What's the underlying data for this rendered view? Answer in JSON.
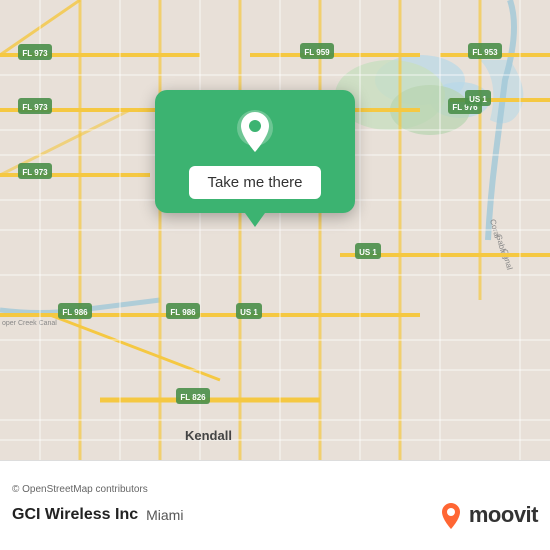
{
  "map": {
    "attribution": "© OpenStreetMap contributors",
    "background_color": "#e8e0d8"
  },
  "popup": {
    "button_label": "Take me there",
    "background_color": "#3cb371"
  },
  "bottom": {
    "attribution": "© OpenStreetMap contributors",
    "location_name": "GCI Wireless Inc",
    "location_city": "Miami",
    "moovit_label": "moovit"
  }
}
